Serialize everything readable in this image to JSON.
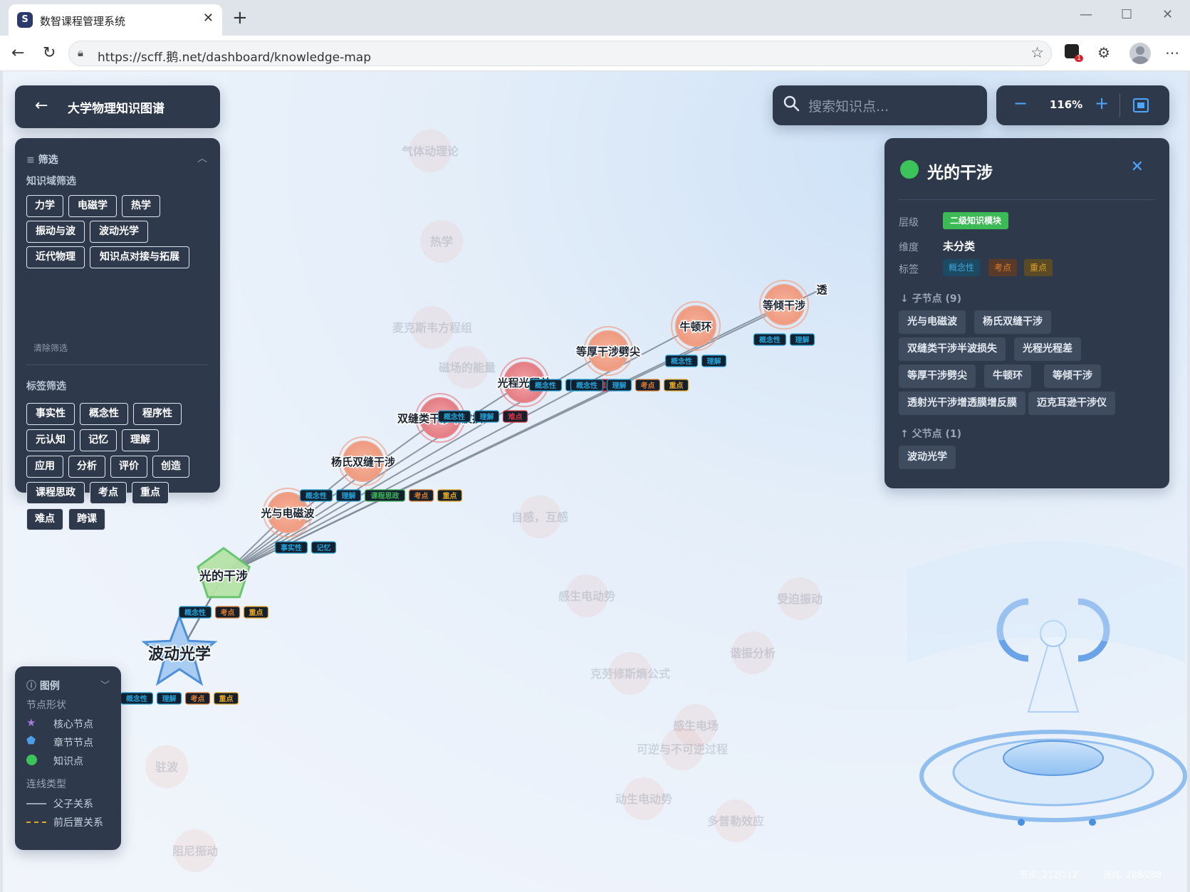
{
  "browser": {
    "tab_title": "数智课程管理系统",
    "tab_close": "✕",
    "new_tab": "+",
    "url": "https://scff.鹅.net/dashboard/knowledge-map",
    "window_min": "—",
    "window_max": "☐",
    "window_close": "✕",
    "notification_count": "1"
  },
  "page": {
    "title": "大学物理知识图谱",
    "search_placeholder": "搜索知识点...",
    "zoom_level": "116%",
    "zoom_out": "−",
    "zoom_in": "+"
  },
  "filters": {
    "heading": "筛选",
    "domain_heading": "知识域筛选",
    "domains": [
      "力学",
      "电磁学",
      "热学",
      "振动与波",
      "波动光学",
      "近代物理",
      "知识点对接与拓展"
    ],
    "clear": "清除筛选",
    "tag_heading": "标签筛选",
    "tags": [
      "事实性",
      "概念性",
      "程序性",
      "元认知",
      "记忆",
      "理解",
      "应用",
      "分析",
      "评价",
      "创造",
      "课程思政",
      "考点",
      "重点",
      "难点",
      "跨课"
    ]
  },
  "legend": {
    "heading": "图例",
    "shape_title": "节点形状",
    "core": "核心节点",
    "chapter": "章节节点",
    "point": "知识点",
    "link_title": "连线类型",
    "parent_child": "父子关系",
    "prereq": "前后置关系"
  },
  "detail": {
    "name": "光的干涉",
    "level_label": "层级",
    "level_value": "二级知识模块",
    "dimension_label": "维度",
    "dimension_value": "未分类",
    "tags_label": "标签",
    "tags": [
      {
        "text": "概念性",
        "color": "#3fa6d8"
      },
      {
        "text": "考点",
        "color": "#e07b2a"
      },
      {
        "text": "重点",
        "color": "#e0a228"
      }
    ],
    "children_heading": "子节点 (9)",
    "children": [
      "光与电磁波",
      "杨氏双缝干涉",
      "双缝类干涉半波损失",
      "光程光程差",
      "等厚干涉劈尖",
      "牛顿环",
      "等倾干涉",
      "透射光干涉增透膜增反膜",
      "迈克耳逊干涉仪"
    ],
    "parents_heading": "父节点 (1)",
    "parents": [
      "波动光学"
    ]
  },
  "stats": {
    "nodes": "节点: 212/212",
    "links": "连线: 288/288"
  },
  "graph": {
    "core": {
      "label": "波动光学",
      "tags": [
        "概念性",
        "理解",
        "考点",
        "重点"
      ]
    },
    "chapter": {
      "label": "光的干涉",
      "tags": [
        "概念性",
        "考点",
        "重点"
      ]
    },
    "points": [
      {
        "label": "光与电磁波",
        "tags": [
          "事实性",
          "记忆"
        ]
      },
      {
        "label": "杨氏双缝干涉",
        "tags": [
          "概念性",
          "理解",
          "课程思政",
          "考点",
          "重点"
        ]
      },
      {
        "label": "双缝类干涉半波损",
        "tags": [
          "概念性",
          "理解",
          "难点"
        ]
      },
      {
        "label": "光程光程差",
        "tags": [
          "概念性",
          "理解",
          "难点"
        ]
      },
      {
        "label": "等厚干涉劈尖",
        "tags": [
          "概念性",
          "理解",
          "考点",
          "重点"
        ]
      },
      {
        "label": "牛顿环",
        "tags": [
          "概念性",
          "理解"
        ]
      },
      {
        "label": "等倾干涉",
        "tags": [
          "概念性",
          "理解"
        ]
      },
      {
        "label": "透",
        "tags": []
      }
    ],
    "ghost_labels": [
      "气体动理论",
      "热学",
      "麦克斯韦方程组",
      "磁场的能量",
      "自感，互感",
      "感生电动势",
      "克劳修斯熵公式",
      "感生电场",
      "可逆与不可逆过程",
      "动生电动势",
      "多普勒效应",
      "驻波",
      "阻尼振动",
      "受迫振动",
      "谐振分析"
    ],
    "tag_colors": {
      "事实性": "#21a3d9",
      "概念性": "#21a3d9",
      "记忆": "#21a3d9",
      "理解": "#21a3d9",
      "课程思政": "#3cb45a",
      "考点": "#e07b2a",
      "重点": "#e6a51e",
      "难点": "#d8343e"
    }
  }
}
